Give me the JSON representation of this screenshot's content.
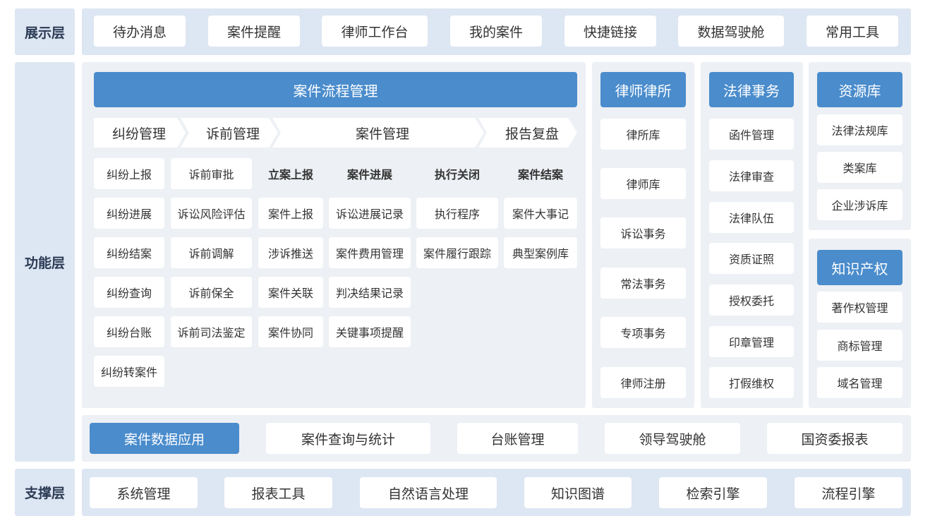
{
  "colors": {
    "accent": "#4a8ccc",
    "layer_bg": "#dde6f3",
    "panel_bg": "#edf0f4"
  },
  "presentation": {
    "label": "展示层",
    "items": [
      "待办消息",
      "案件提醒",
      "律师工作台",
      "我的案件",
      "快捷链接",
      "数据驾驶舱",
      "常用工具"
    ]
  },
  "function": {
    "label": "功能层",
    "case_flow": {
      "title": "案件流程管理",
      "stages": [
        "纠纷管理",
        "诉前管理",
        "案件管理",
        "报告复盘"
      ],
      "col_heads": [
        "立案上报",
        "案件进展",
        "执行关闭",
        "案件结案"
      ],
      "dispute": [
        "纠纷上报",
        "纠纷进展",
        "纠纷结案",
        "纠纷查询",
        "纠纷台账",
        "纠纷转案件"
      ],
      "pre_litigation": [
        "诉前审批",
        "诉讼风险评估",
        "诉前调解",
        "诉前保全",
        "诉前司法鉴定"
      ],
      "filing": [
        "案件上报",
        "涉诉推送",
        "案件关联",
        "案件协同"
      ],
      "progress": [
        "诉讼进展记录",
        "案件费用管理",
        "判决结果记录",
        "关键事项提醒"
      ],
      "execution": [
        "执行程序",
        "案件履行跟踪"
      ],
      "closing": [
        "案件大事记",
        "典型案例库"
      ]
    },
    "lawyers": {
      "title": "律师律所",
      "items": [
        "律所库",
        "律师库",
        "诉讼事务",
        "常法事务",
        "专项事务",
        "律师注册"
      ]
    },
    "legal_affairs": {
      "title": "法律事务",
      "items": [
        "函件管理",
        "法律审查",
        "法律队伍",
        "资质证照",
        "授权委托",
        "印章管理",
        "打假维权"
      ]
    },
    "resources": {
      "title": "资源库",
      "items": [
        "法律法规库",
        "类案库",
        "企业涉诉库"
      ]
    },
    "ip": {
      "title": "知识产权",
      "items": [
        "著作权管理",
        "商标管理",
        "域名管理"
      ]
    },
    "data_app": {
      "items": [
        "案件数据应用",
        "案件查询与统计",
        "台账管理",
        "领导驾驶舱",
        "国资委报表"
      ]
    }
  },
  "support": {
    "label": "支撑层",
    "items": [
      "系统管理",
      "报表工具",
      "自然语言处理",
      "知识图谱",
      "检索引擎",
      "流程引擎"
    ]
  }
}
